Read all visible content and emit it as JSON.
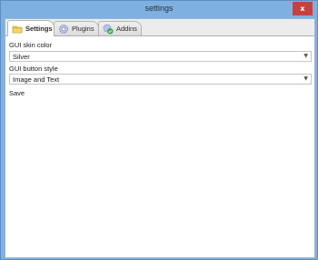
{
  "window": {
    "title": "settings",
    "close_glyph": "x",
    "close_color": "#c7413c",
    "frame_color": "#7fb1e0"
  },
  "tabs": [
    {
      "label": "Settings",
      "icon": "folder-icon",
      "active": true
    },
    {
      "label": "Plugins",
      "icon": "gear-icon",
      "active": false
    },
    {
      "label": "Addins",
      "icon": "addin-gear-check-icon",
      "active": false
    }
  ],
  "settings": {
    "skin_label": "GUI skin color",
    "skin_value": "Silver",
    "button_style_label": "GUI button style",
    "button_style_value": "Image and Text",
    "save_label": "Save"
  },
  "icons": {
    "dropdown": "chevron-down-icon"
  }
}
